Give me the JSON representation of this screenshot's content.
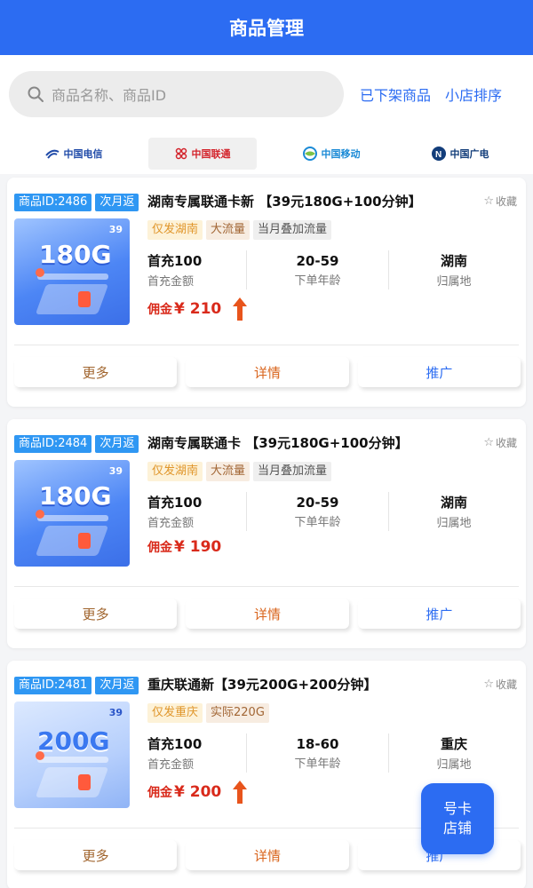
{
  "header": {
    "title": "商品管理"
  },
  "search": {
    "placeholder": "商品名称、商品ID",
    "link_delisted": "已下架商品",
    "link_sort": "小店排序"
  },
  "carriers": [
    {
      "label": "中国电信",
      "active": false
    },
    {
      "label": "中国联通",
      "active": true
    },
    {
      "label": "中国移动",
      "active": false
    },
    {
      "label": "中国广电",
      "active": false
    }
  ],
  "cards": [
    {
      "id_badge": "商品ID:2486",
      "return_badge": "次月返",
      "title": "湖南专属联通卡新 【39元180G+100分钟】",
      "fav": "收藏",
      "thumb_price": "39",
      "thumb_big": "180G",
      "tags": [
        {
          "text": "仅发湖南",
          "style": "orange"
        },
        {
          "text": "大流量",
          "style": "brown"
        },
        {
          "text": "当月叠加流量",
          "style": "gray"
        }
      ],
      "stats": [
        {
          "value": "首充100",
          "label": "首充金额"
        },
        {
          "value": "20-59",
          "label": "下单年龄"
        },
        {
          "value": "湖南",
          "label": "归属地"
        }
      ],
      "commission_label": "佣金",
      "commission_amount": "¥ 210",
      "has_up_arrow": true,
      "actions": {
        "more": "更多",
        "detail": "详情",
        "promote": "推广"
      }
    },
    {
      "id_badge": "商品ID:2484",
      "return_badge": "次月返",
      "title": "湖南专属联通卡 【39元180G+100分钟】",
      "fav": "收藏",
      "thumb_price": "39",
      "thumb_big": "180G",
      "tags": [
        {
          "text": "仅发湖南",
          "style": "orange"
        },
        {
          "text": "大流量",
          "style": "brown"
        },
        {
          "text": "当月叠加流量",
          "style": "gray"
        }
      ],
      "stats": [
        {
          "value": "首充100",
          "label": "首充金额"
        },
        {
          "value": "20-59",
          "label": "下单年龄"
        },
        {
          "value": "湖南",
          "label": "归属地"
        }
      ],
      "commission_label": "佣金",
      "commission_amount": "¥ 190",
      "has_up_arrow": false,
      "actions": {
        "more": "更多",
        "detail": "详情",
        "promote": "推广"
      }
    },
    {
      "id_badge": "商品ID:2481",
      "return_badge": "次月返",
      "title": "重庆联通新【39元200G+200分钟】",
      "fav": "收藏",
      "thumb_price": "39",
      "thumb_big": "200G",
      "tags": [
        {
          "text": "仅发重庆",
          "style": "orange"
        },
        {
          "text": "实际220G",
          "style": "brown"
        }
      ],
      "stats": [
        {
          "value": "首充100",
          "label": "首充金额"
        },
        {
          "value": "18-60",
          "label": "下单年龄"
        },
        {
          "value": "重庆",
          "label": "归属地"
        }
      ],
      "commission_label": "佣金",
      "commission_amount": "¥ 200",
      "has_up_arrow": true,
      "actions": {
        "more": "更多",
        "detail": "详情",
        "promote": "推广"
      }
    }
  ],
  "float_button": {
    "line1": "号卡",
    "line2": "店铺"
  },
  "colors": {
    "primary": "#2c6cf2",
    "badge_blue": "#2f97f3",
    "commission_red": "#d92a1b"
  }
}
